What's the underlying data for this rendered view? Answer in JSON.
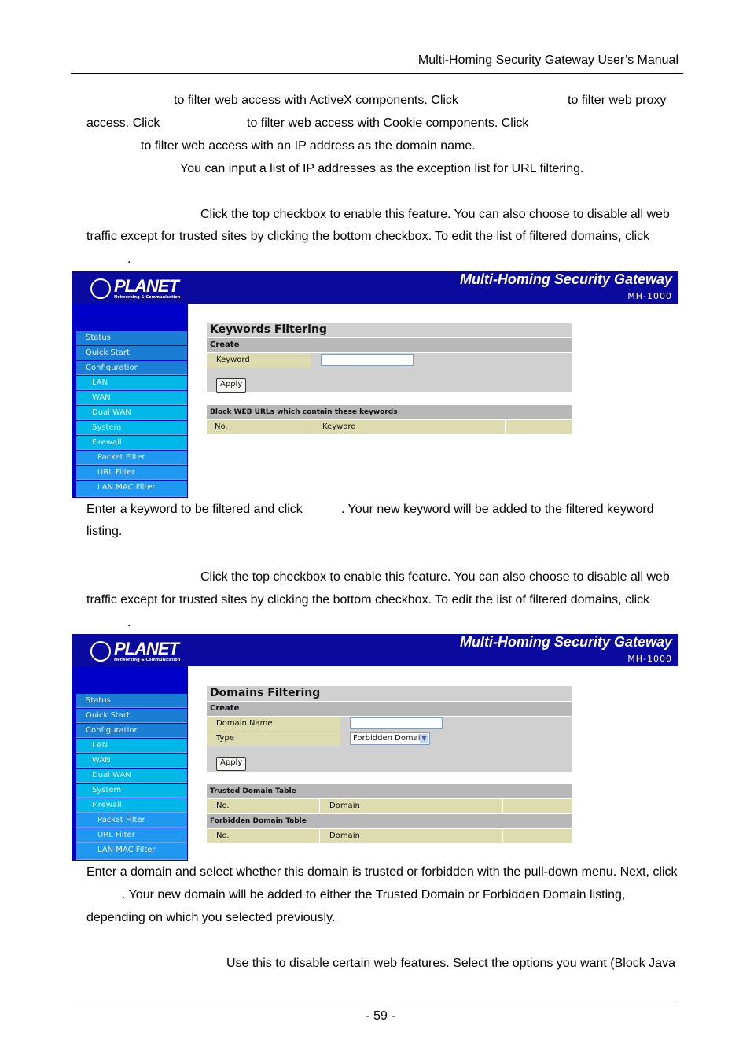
{
  "header": {
    "title": "Multi-Homing  Security  Gateway  User’s  Manual"
  },
  "para1": {
    "l1a": "to filter web access with ActiveX components. Click",
    "l1b": "to filter web proxy",
    "l2a": "access. Click",
    "l2b": "to filter web access with Cookie components. Click",
    "l3": "to filter web access with an IP address as the domain name.",
    "l4": "You can input a list of IP addresses as the exception list for URL filtering."
  },
  "para2": {
    "l1": "Click the top checkbox to enable this feature. You can also choose to disable all web",
    "l2": "traffic except for trusted sites by clicking the bottom checkbox. To edit the list of filtered domains, click",
    "l3": "."
  },
  "para3": {
    "l1a": "Enter a keyword to be filtered and click",
    "l1b": ". Your new keyword will be added to the filtered keyword",
    "l2": "listing."
  },
  "para4": {
    "l1": "Click the top checkbox to enable this feature. You can also choose to disable all web",
    "l2": "traffic except for trusted sites by clicking the bottom checkbox. To edit the list of filtered domains, click",
    "l3": "."
  },
  "para5": {
    "l1": "Enter a domain and select whether this domain is trusted or forbidden with the pull-down menu. Next, click",
    "l2": ". Your new domain will be added to either the Trusted Domain or Forbidden Domain listing,",
    "l3": "depending on which you selected previously."
  },
  "para6": {
    "l1": "Use this to disable certain web features. Select the options you want (Block Java"
  },
  "footer": {
    "page": "- 59 -"
  },
  "app": {
    "logo": "PLANET",
    "logo_sub": "Networking & Communication",
    "product": "Multi-Homing Security Gateway",
    "model": "MH-1000",
    "menu": [
      "Status",
      "Quick Start",
      "Configuration",
      "LAN",
      "WAN",
      "Dual WAN",
      "System",
      "Firewall",
      "Packet Filter",
      "URL Filter",
      "LAN MAC Filter"
    ]
  },
  "shot1": {
    "title": "Keywords Filtering",
    "create": "Create",
    "keyword_label": "Keyword",
    "keyword_value": "",
    "apply": "Apply",
    "table_title": "Block WEB URLs which contain these keywords",
    "col_no": "No.",
    "col_keyword": "Keyword"
  },
  "shot2": {
    "title": "Domains Filtering",
    "create": "Create",
    "domain_label": "Domain Name",
    "domain_value": "",
    "type_label": "Type",
    "type_value": "Forbidden Domain",
    "apply": "Apply",
    "trusted_title": "Trusted Domain Table",
    "forbidden_title": "Forbidden Domain Table",
    "col_no": "No.",
    "col_domain": "Domain"
  }
}
